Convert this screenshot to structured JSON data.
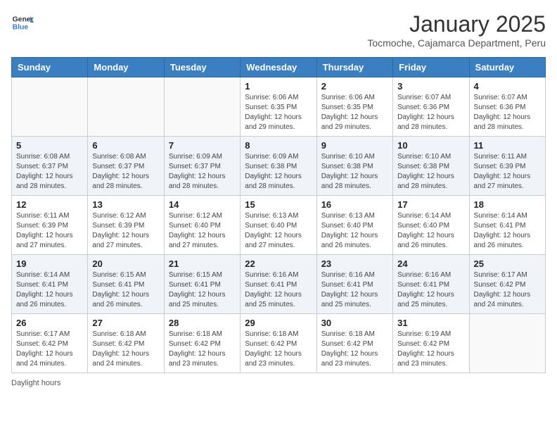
{
  "header": {
    "logo_general": "General",
    "logo_blue": "Blue",
    "month_title": "January 2025",
    "subtitle": "Tocmoche, Cajamarca Department, Peru"
  },
  "weekdays": [
    "Sunday",
    "Monday",
    "Tuesday",
    "Wednesday",
    "Thursday",
    "Friday",
    "Saturday"
  ],
  "weeks": [
    [
      {
        "day": "",
        "info": ""
      },
      {
        "day": "",
        "info": ""
      },
      {
        "day": "",
        "info": ""
      },
      {
        "day": "1",
        "info": "Sunrise: 6:06 AM\nSunset: 6:35 PM\nDaylight: 12 hours and 29 minutes."
      },
      {
        "day": "2",
        "info": "Sunrise: 6:06 AM\nSunset: 6:35 PM\nDaylight: 12 hours and 29 minutes."
      },
      {
        "day": "3",
        "info": "Sunrise: 6:07 AM\nSunset: 6:36 PM\nDaylight: 12 hours and 28 minutes."
      },
      {
        "day": "4",
        "info": "Sunrise: 6:07 AM\nSunset: 6:36 PM\nDaylight: 12 hours and 28 minutes."
      }
    ],
    [
      {
        "day": "5",
        "info": "Sunrise: 6:08 AM\nSunset: 6:37 PM\nDaylight: 12 hours and 28 minutes."
      },
      {
        "day": "6",
        "info": "Sunrise: 6:08 AM\nSunset: 6:37 PM\nDaylight: 12 hours and 28 minutes."
      },
      {
        "day": "7",
        "info": "Sunrise: 6:09 AM\nSunset: 6:37 PM\nDaylight: 12 hours and 28 minutes."
      },
      {
        "day": "8",
        "info": "Sunrise: 6:09 AM\nSunset: 6:38 PM\nDaylight: 12 hours and 28 minutes."
      },
      {
        "day": "9",
        "info": "Sunrise: 6:10 AM\nSunset: 6:38 PM\nDaylight: 12 hours and 28 minutes."
      },
      {
        "day": "10",
        "info": "Sunrise: 6:10 AM\nSunset: 6:38 PM\nDaylight: 12 hours and 28 minutes."
      },
      {
        "day": "11",
        "info": "Sunrise: 6:11 AM\nSunset: 6:39 PM\nDaylight: 12 hours and 27 minutes."
      }
    ],
    [
      {
        "day": "12",
        "info": "Sunrise: 6:11 AM\nSunset: 6:39 PM\nDaylight: 12 hours and 27 minutes."
      },
      {
        "day": "13",
        "info": "Sunrise: 6:12 AM\nSunset: 6:39 PM\nDaylight: 12 hours and 27 minutes."
      },
      {
        "day": "14",
        "info": "Sunrise: 6:12 AM\nSunset: 6:40 PM\nDaylight: 12 hours and 27 minutes."
      },
      {
        "day": "15",
        "info": "Sunrise: 6:13 AM\nSunset: 6:40 PM\nDaylight: 12 hours and 27 minutes."
      },
      {
        "day": "16",
        "info": "Sunrise: 6:13 AM\nSunset: 6:40 PM\nDaylight: 12 hours and 26 minutes."
      },
      {
        "day": "17",
        "info": "Sunrise: 6:14 AM\nSunset: 6:40 PM\nDaylight: 12 hours and 26 minutes."
      },
      {
        "day": "18",
        "info": "Sunrise: 6:14 AM\nSunset: 6:41 PM\nDaylight: 12 hours and 26 minutes."
      }
    ],
    [
      {
        "day": "19",
        "info": "Sunrise: 6:14 AM\nSunset: 6:41 PM\nDaylight: 12 hours and 26 minutes."
      },
      {
        "day": "20",
        "info": "Sunrise: 6:15 AM\nSunset: 6:41 PM\nDaylight: 12 hours and 26 minutes."
      },
      {
        "day": "21",
        "info": "Sunrise: 6:15 AM\nSunset: 6:41 PM\nDaylight: 12 hours and 25 minutes."
      },
      {
        "day": "22",
        "info": "Sunrise: 6:16 AM\nSunset: 6:41 PM\nDaylight: 12 hours and 25 minutes."
      },
      {
        "day": "23",
        "info": "Sunrise: 6:16 AM\nSunset: 6:41 PM\nDaylight: 12 hours and 25 minutes."
      },
      {
        "day": "24",
        "info": "Sunrise: 6:16 AM\nSunset: 6:41 PM\nDaylight: 12 hours and 25 minutes."
      },
      {
        "day": "25",
        "info": "Sunrise: 6:17 AM\nSunset: 6:42 PM\nDaylight: 12 hours and 24 minutes."
      }
    ],
    [
      {
        "day": "26",
        "info": "Sunrise: 6:17 AM\nSunset: 6:42 PM\nDaylight: 12 hours and 24 minutes."
      },
      {
        "day": "27",
        "info": "Sunrise: 6:18 AM\nSunset: 6:42 PM\nDaylight: 12 hours and 24 minutes."
      },
      {
        "day": "28",
        "info": "Sunrise: 6:18 AM\nSunset: 6:42 PM\nDaylight: 12 hours and 23 minutes."
      },
      {
        "day": "29",
        "info": "Sunrise: 6:18 AM\nSunset: 6:42 PM\nDaylight: 12 hours and 23 minutes."
      },
      {
        "day": "30",
        "info": "Sunrise: 6:18 AM\nSunset: 6:42 PM\nDaylight: 12 hours and 23 minutes."
      },
      {
        "day": "31",
        "info": "Sunrise: 6:19 AM\nSunset: 6:42 PM\nDaylight: 12 hours and 23 minutes."
      },
      {
        "day": "",
        "info": ""
      }
    ]
  ],
  "footer": {
    "daylight_label": "Daylight hours"
  }
}
